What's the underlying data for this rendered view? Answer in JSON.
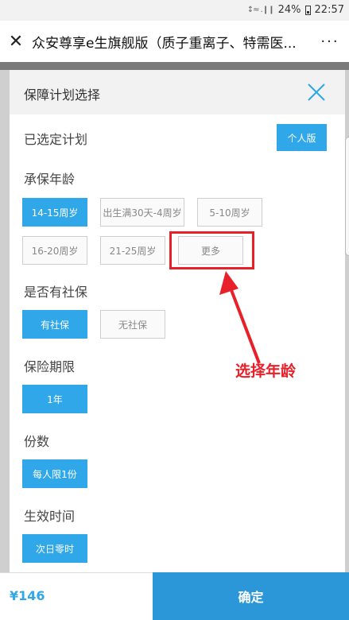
{
  "status_bar": {
    "signal": "↕≈ .❙❙",
    "battery": "24%",
    "time": "22:57"
  },
  "title_bar": {
    "title": "众安尊享e生旗舰版（质子重离子、特需医...",
    "more": "···"
  },
  "panel": {
    "title": "保障计划选择",
    "selected_plan_label": "已选定计划",
    "selected_plan_value": "个人版",
    "age_label": "承保年龄",
    "ages": [
      "14-15周岁",
      "出生满30天-4周岁",
      "5-10周岁",
      "16-20周岁",
      "21-25周岁",
      "更多"
    ],
    "selected_age_index": 0,
    "social_label": "是否有社保",
    "social_options": [
      "有社保",
      "无社保"
    ],
    "term_label": "保险期限",
    "term_value": "1年",
    "count_label": "份数",
    "count_value": "每人限1份",
    "effective_label": "生效时间",
    "effective_value": "次日零时"
  },
  "annotation": {
    "text": "选择年龄",
    "color": "#e8202a"
  },
  "bottom": {
    "price": "¥146",
    "confirm": "确定"
  },
  "colors": {
    "accent": "#2fa7e8",
    "confirm_bg": "#2b96d8"
  }
}
